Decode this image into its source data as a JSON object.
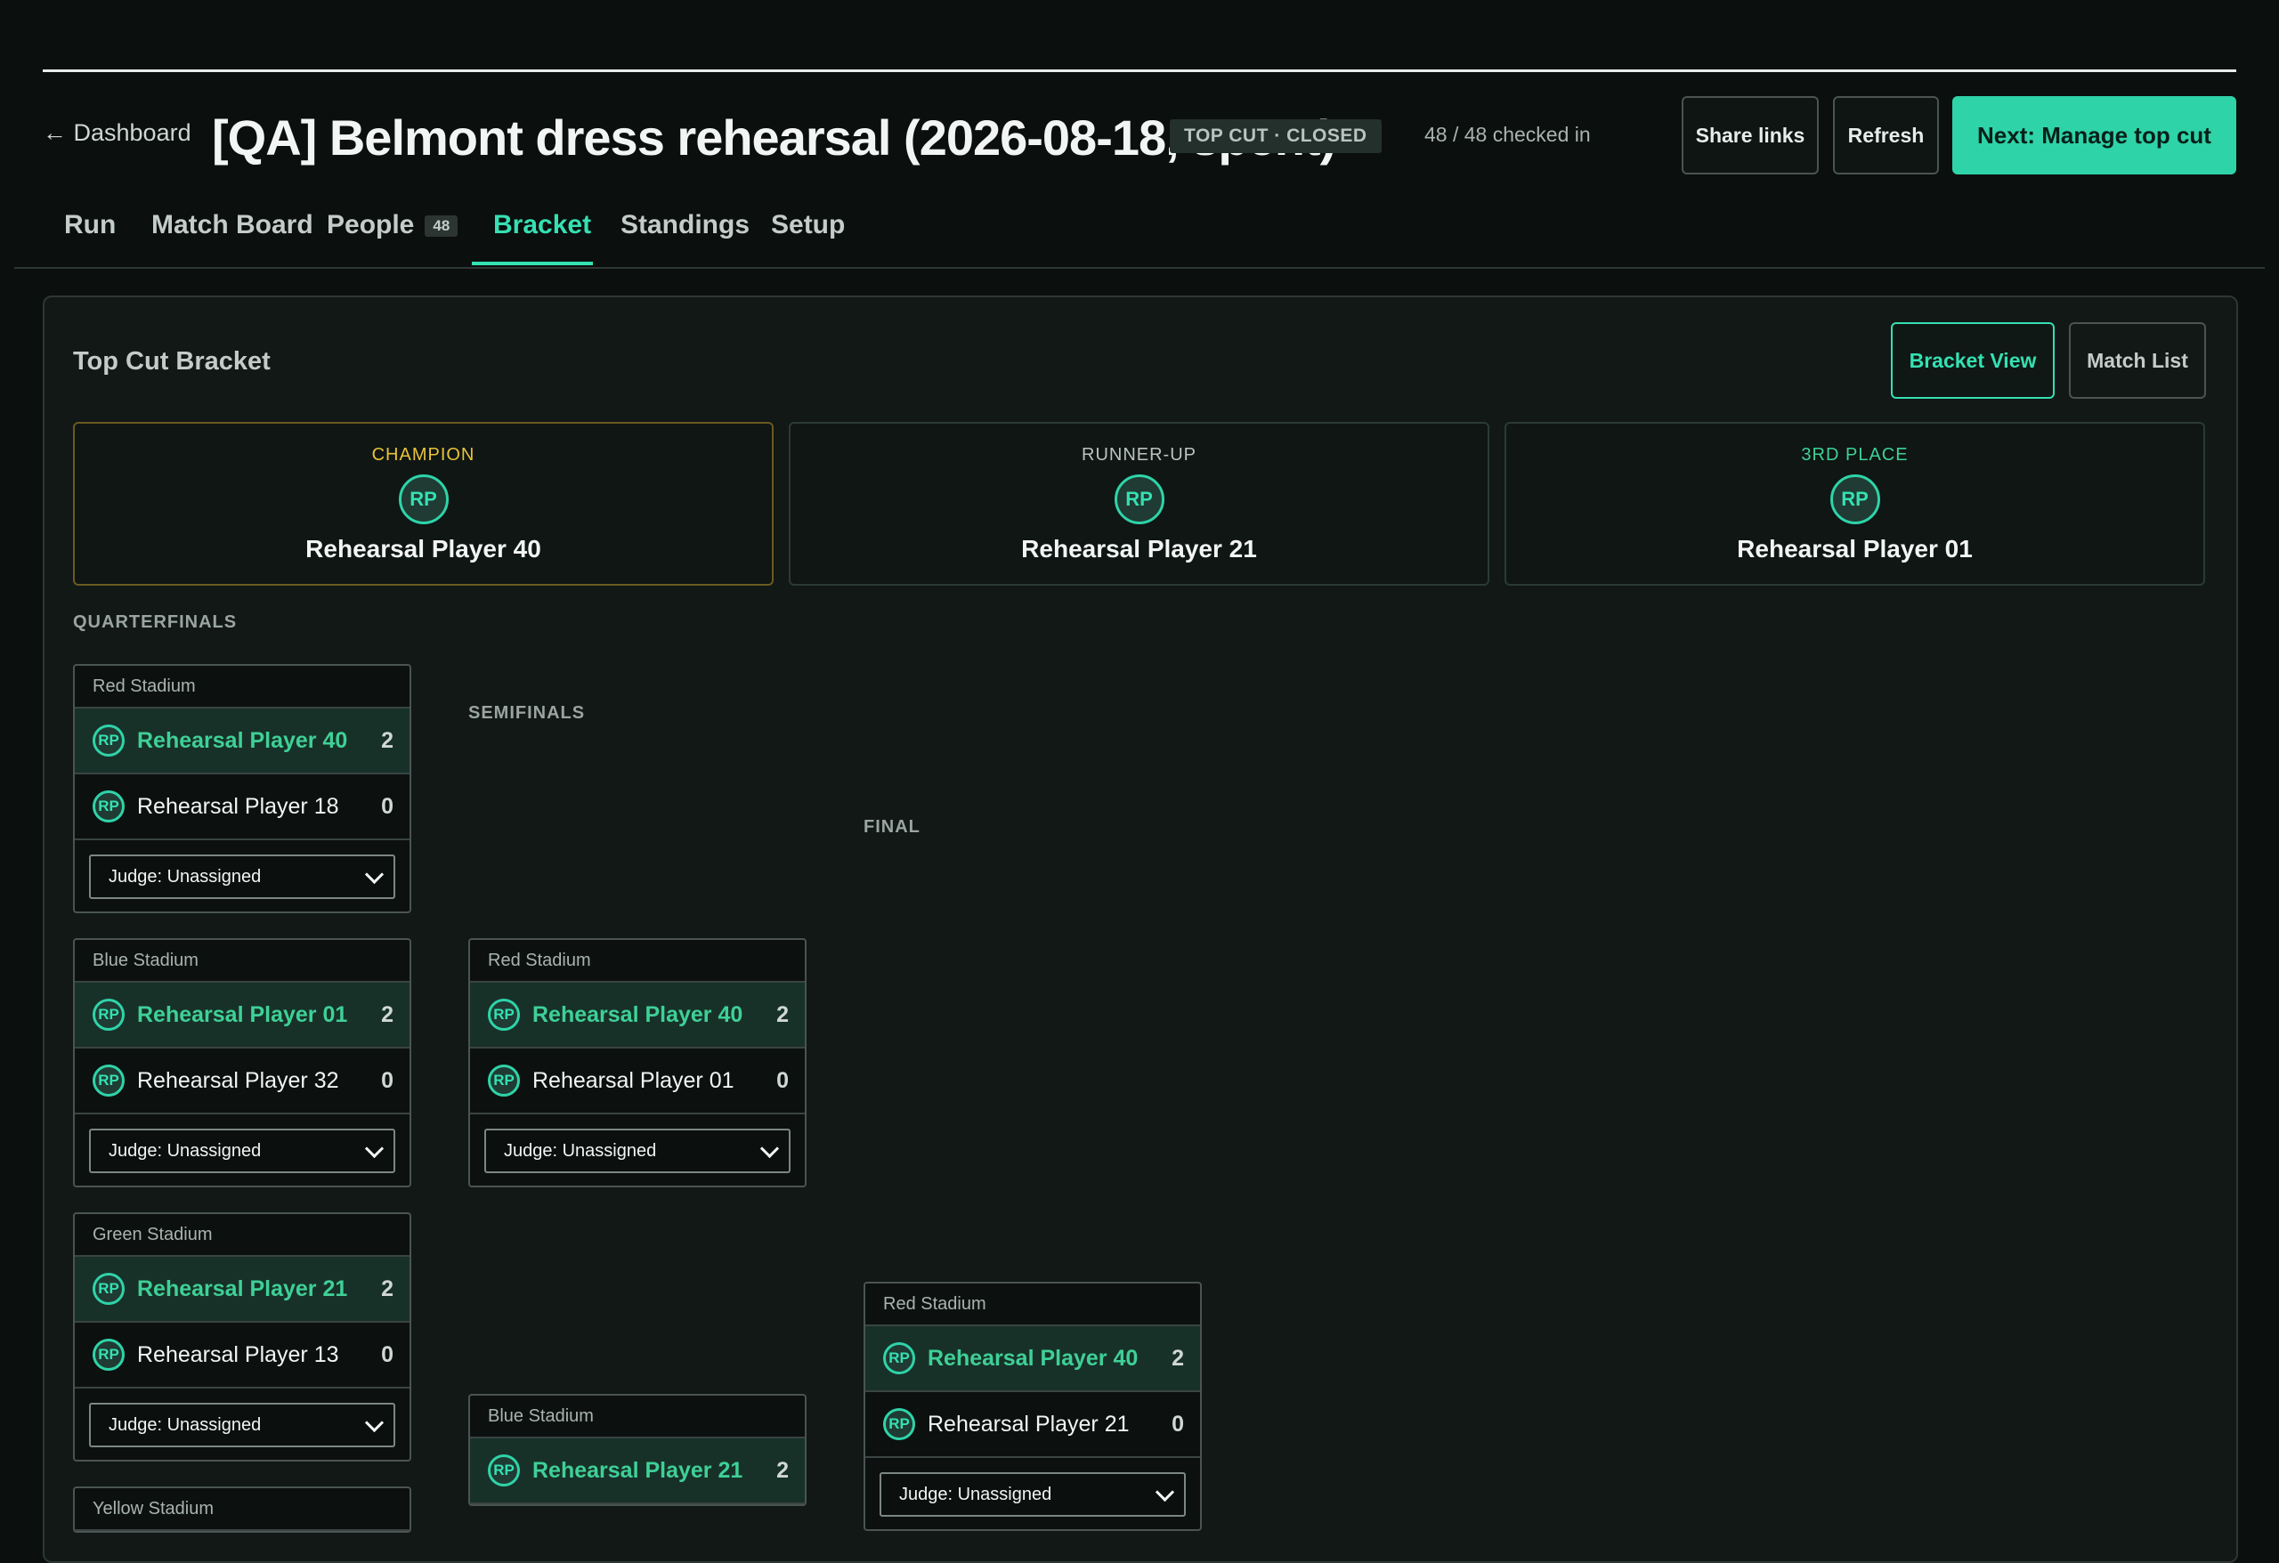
{
  "header": {
    "back_label": "← Dashboard",
    "title": "[QA] Belmont dress rehearsal (2026-08-18, spent)",
    "status_badge": "TOP CUT · CLOSED",
    "checked_in": "48 / 48 checked in",
    "share_label": "Share links",
    "refresh_label": "Refresh",
    "next_label": "Next: Manage top cut"
  },
  "tabs": {
    "run": "Run",
    "match_board": "Match Board",
    "people": "People",
    "people_count": "48",
    "bracket": "Bracket",
    "standings": "Standings",
    "setup": "Setup",
    "active": "Bracket"
  },
  "panel": {
    "title": "Top Cut Bracket",
    "bracket_view": "Bracket View",
    "match_list": "Match List"
  },
  "podium": {
    "champion": {
      "label": "CHAMPION",
      "initials": "RP",
      "name": "Rehearsal Player 40",
      "color": "#e8c23a"
    },
    "runner_up": {
      "label": "RUNNER-UP",
      "initials": "RP",
      "name": "Rehearsal Player 21",
      "color": "#b9c4c0"
    },
    "third": {
      "label": "3RD PLACE",
      "initials": "RP",
      "name": "Rehearsal Player 01",
      "color": "#3fd097"
    }
  },
  "rounds": {
    "quarterfinals": "QUARTERFINALS",
    "semifinals": "SEMIFINALS",
    "final": "FINAL"
  },
  "matches": {
    "qf1": {
      "stadium": "Red Stadium",
      "p1": {
        "initials": "RP",
        "name": "Rehearsal Player 40",
        "score": "2"
      },
      "p2": {
        "initials": "RP",
        "name": "Rehearsal Player 18",
        "score": "0"
      },
      "judge": "Judge: Unassigned"
    },
    "qf2": {
      "stadium": "Blue Stadium",
      "p1": {
        "initials": "RP",
        "name": "Rehearsal Player 01",
        "score": "2"
      },
      "p2": {
        "initials": "RP",
        "name": "Rehearsal Player 32",
        "score": "0"
      },
      "judge": "Judge: Unassigned"
    },
    "qf3": {
      "stadium": "Green Stadium",
      "p1": {
        "initials": "RP",
        "name": "Rehearsal Player 21",
        "score": "2"
      },
      "p2": {
        "initials": "RP",
        "name": "Rehearsal Player 13",
        "score": "0"
      },
      "judge": "Judge: Unassigned"
    },
    "qf4": {
      "stadium": "Yellow Stadium"
    },
    "sf1": {
      "stadium": "Red Stadium",
      "p1": {
        "initials": "RP",
        "name": "Rehearsal Player 40",
        "score": "2"
      },
      "p2": {
        "initials": "RP",
        "name": "Rehearsal Player 01",
        "score": "0"
      },
      "judge": "Judge: Unassigned"
    },
    "sf2": {
      "stadium": "Blue Stadium",
      "p1": {
        "initials": "RP",
        "name": "Rehearsal Player 21",
        "score": "2"
      }
    },
    "final": {
      "stadium": "Red Stadium",
      "p1": {
        "initials": "RP",
        "name": "Rehearsal Player 40",
        "score": "2"
      },
      "p2": {
        "initials": "RP",
        "name": "Rehearsal Player 21",
        "score": "0"
      },
      "judge": "Judge: Unassigned"
    }
  }
}
